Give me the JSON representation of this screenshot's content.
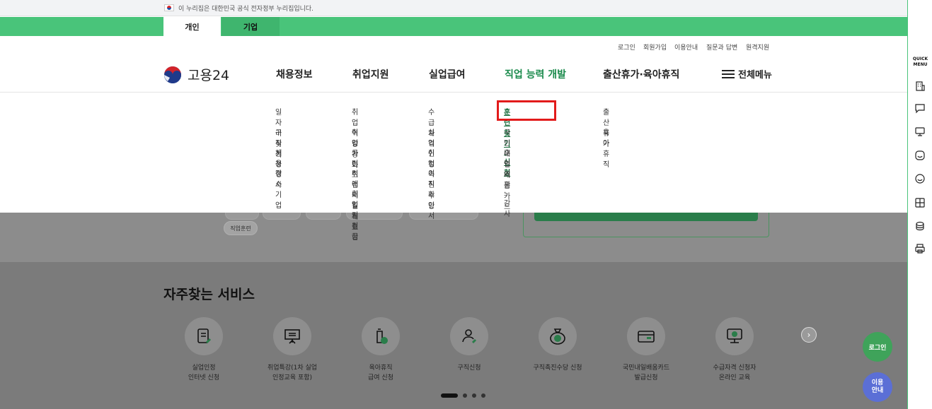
{
  "gov_banner": {
    "text": "이 누리집은 대한민국 공식 전자정부 누리집입니다."
  },
  "tabs": {
    "personal": "개인",
    "corporate": "기업"
  },
  "util_links": [
    "로그인",
    "회원가입",
    "이용안내",
    "질문과 답변",
    "원격지원"
  ],
  "logo": {
    "text": "고용24"
  },
  "nav": {
    "items": [
      "채용정보",
      "취업지원",
      "실업급여",
      "직업 능력 개발",
      "출산휴가·육아휴직"
    ],
    "active_index": 3,
    "all_menu": "전체메뉴"
  },
  "mega_menu": {
    "col1": [
      "일자리 찾기",
      "구직신청",
      "채용행사",
      "강소기업"
    ],
    "col2": [
      "취업역량강화",
      "취업가이드",
      "국민취업지원제도",
      "미래내일 일경험",
      "취업지원금"
    ],
    "col3": [
      "수급자격",
      "실업인정",
      "취업촉진수당",
      "이직확인서"
    ],
    "col4": [
      "훈련 찾기·신청",
      "국민내일배움카드",
      "훈련 기관·강사"
    ],
    "col5": [
      "출산휴가",
      "육아휴직"
    ],
    "highlighted": "훈련 찾기·신청"
  },
  "chip_label": "직업훈련",
  "frequent": {
    "title": "자주찾는 서비스",
    "services": [
      {
        "line1": "실업인정",
        "line2": "인터넷 신청",
        "icon": "document-pen-icon"
      },
      {
        "line1": "취업특강(1차 실업",
        "line2": "인정교육 포함)",
        "icon": "presentation-board-icon"
      },
      {
        "line1": "육아휴직",
        "line2": "급여 신청",
        "icon": "baby-bottle-icon"
      },
      {
        "line1": "구직신청",
        "line2": "",
        "icon": "person-pen-icon"
      },
      {
        "line1": "구직촉진수당 신청",
        "line2": "",
        "icon": "money-bag-won-icon"
      },
      {
        "line1": "국민내일배움카드",
        "line2": "발급신청",
        "icon": "card-icon"
      },
      {
        "line1": "수급자격 신청자",
        "line2": "온라인 교육",
        "icon": "monitor-play-icon"
      }
    ]
  },
  "floating": {
    "login": "로그인",
    "guide_line1": "이용",
    "guide_line2": "안내"
  },
  "quick_menu": {
    "title_line1": "QUICK",
    "title_line2": "MENU"
  },
  "colors": {
    "brand_green": "#49c47a",
    "highlight_red": "#e21b1b",
    "active_nav": "#1a8a4c"
  }
}
